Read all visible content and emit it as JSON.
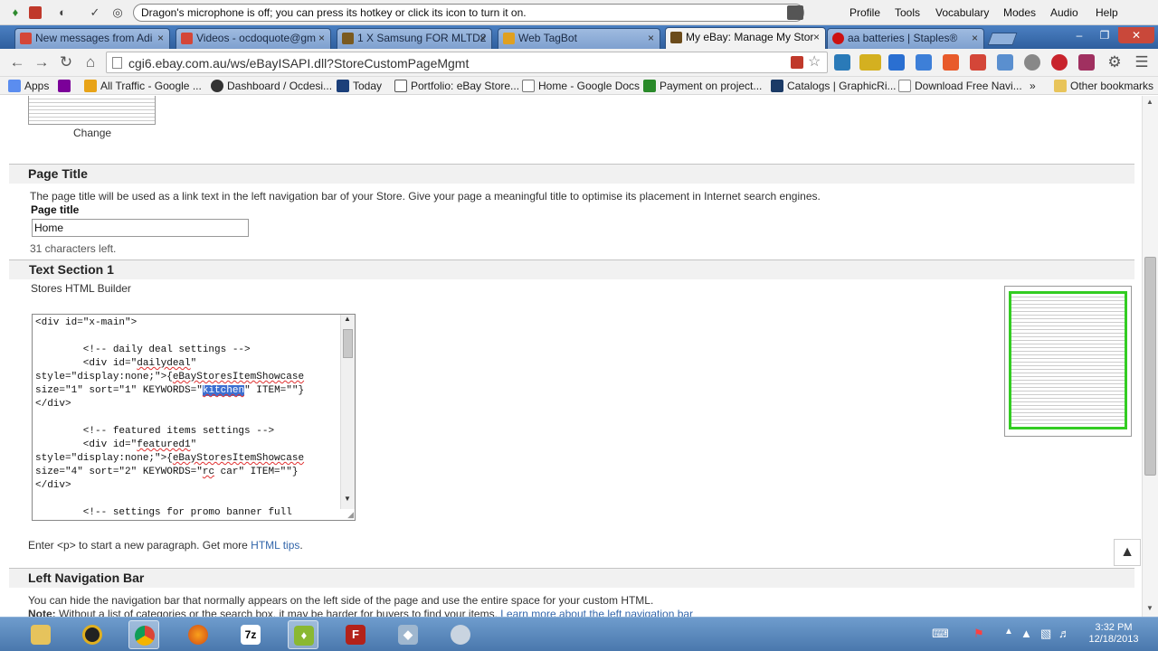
{
  "dragon": {
    "message": "Dragon's microphone is off; you can press its hotkey or click its icon to turn it on.",
    "menus": [
      "Profile",
      "Tools",
      "Vocabulary",
      "Modes",
      "Audio",
      "Help"
    ]
  },
  "tabs": [
    {
      "label": "New messages from Adi",
      "color": "#d44638"
    },
    {
      "label": "Videos - ocdoquote@gm",
      "color": "#d44638"
    },
    {
      "label": "1 X Samsung FOR MLTD2",
      "color": "#7a5a20"
    },
    {
      "label": "Web TagBot",
      "color": "#e0a020"
    },
    {
      "label": "My eBay: Manage My Stor",
      "color": "#6b4b1b"
    },
    {
      "label": "aa batteries | Staples®",
      "color": "#cc1111"
    }
  ],
  "toolbar": {
    "url": "cgi6.ebay.com.au/ws/eBayISAPI.dll?StoreCustomPageMgmt"
  },
  "bookmarks": [
    {
      "label": "Apps",
      "color": "#5b8def"
    },
    {
      "label": "",
      "color": "#7b0099"
    },
    {
      "label": "All Traffic - Google ...",
      "color": "#e8a317"
    },
    {
      "label": "Dashboard / Ocdesi...",
      "color": "#333333"
    },
    {
      "label": "Today",
      "color": "#1b3f7a"
    },
    {
      "label": "Portfolio: eBay Store...",
      "color": "#3a3a3a"
    },
    {
      "label": "Home - Google Docs",
      "color": "#777777"
    },
    {
      "label": "Payment on project...",
      "color": "#2a8a2a"
    },
    {
      "label": "Catalogs | GraphicRi...",
      "color": "#1b3a66"
    },
    {
      "label": "Download Free Navi...",
      "color": "#888888"
    }
  ],
  "bookmarks_more": "»",
  "other_bookmarks": "Other bookmarks",
  "page": {
    "change_link": "Change",
    "page_title_section": {
      "heading": "Page Title",
      "description": "The page title will be used as a link text in the left navigation bar of your Store. Give your page a meaningful title to optimise its placement in Internet search engines.",
      "field_label": "Page title",
      "field_value": "Home",
      "chars_left": "31 characters left."
    },
    "text_section": {
      "heading": "Text Section 1",
      "builder_link": "Stores HTML Builder",
      "hint_prefix": "Enter <p> to start a new paragraph. Get more",
      "hint_link": "HTML tips",
      "hint_suffix": "."
    },
    "editor": {
      "l1": "<div id=\"x-main\">",
      "l2": "        <!-- daily deal settings -->",
      "l3a": "        <div id=\"",
      "l3b": "dailydeal",
      "l3c": "\"",
      "l4a": "style=\"display:none;\">{",
      "l4b": "eBayStoresItemShowcase",
      "l5a": "size=\"1\" sort=\"1\" KEYWORDS=\"",
      "l5b": "kitchen",
      "l5c": "\" ITEM=\"\"}",
      "l6": "</div>",
      "l7": "        <!-- featured items settings -->",
      "l8a": "        <div id=\"",
      "l8b": "featured1",
      "l8c": "\"",
      "l9a": "style=\"display:none;\">{",
      "l9b": "eBayStoresItemShowcase",
      "l10a": "size=\"4\" sort=\"2\" KEYWORDS=\"",
      "l10b": "rc",
      "l10c": " car\" ITEM=\"\"}",
      "l11": "</div>",
      "l12": "        <!-- settings for promo banner full"
    },
    "left_nav_section": {
      "heading": "Left Navigation Bar",
      "description": "You can hide the navigation bar that normally appears on the left side of the page and use the entire space for your custom HTML.",
      "note_label": "Note:",
      "note_text": "Without a list of categories or the search box, it may be harder for buyers to find your items.",
      "note_link": "Learn more about the left navigation bar"
    }
  },
  "taskbar": {
    "time": "3:32 PM",
    "date": "12/18/2013"
  }
}
